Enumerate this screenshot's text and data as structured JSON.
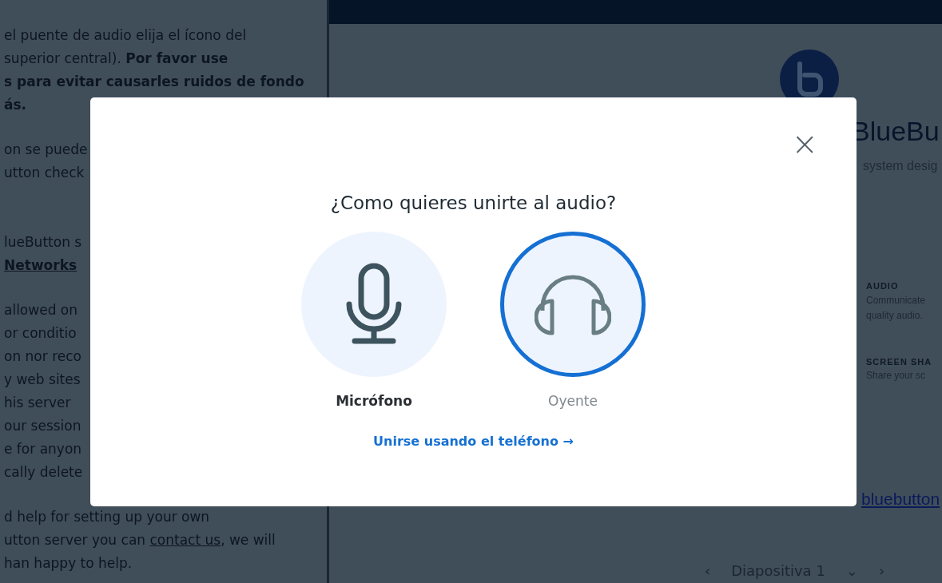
{
  "left_panel": {
    "paragraphs": [
      [
        "el puente de audio elija el ícono del",
        "superior central). **Por favor use**",
        "**s para evitar causarles ruidos de fondo**",
        "**ás.**"
      ],
      [
        "on se puede",
        "utton check"
      ],
      [
        "lueButton s",
        {
          "link": "Networks"
        }
      ],
      [
        "allowed on",
        "or conditio",
        "on nor reco",
        "y web sites",
        "his server",
        "our session",
        "e for anyon",
        "cally delete"
      ],
      [
        "d help for setting up your own",
        {
          "before": "utton server you can ",
          "link": "contact us",
          "after": ", we will"
        },
        "han happy to help."
      ]
    ]
  },
  "right_panel": {
    "heading": "BlueBu",
    "subtitle": "system desig",
    "features": [
      {
        "title": "AUDIO",
        "lines": [
          "Communicate",
          "quality audio."
        ]
      },
      {
        "title": "SCREEN SHA",
        "lines": [
          "Share your sc"
        ]
      }
    ],
    "link": "bluebutton",
    "pager": {
      "prev": "‹",
      "label": "Diapositiva 1",
      "caret": "⌄",
      "next": "›"
    }
  },
  "modal": {
    "title": "¿Como quieres unirte al audio?",
    "close": "×",
    "options": [
      {
        "kind": "microphone",
        "label": "Micrófono",
        "selected": false
      },
      {
        "kind": "headphones",
        "label": "Oyente",
        "selected": true
      }
    ],
    "phone_link": "Unirse usando el teléfono →"
  }
}
